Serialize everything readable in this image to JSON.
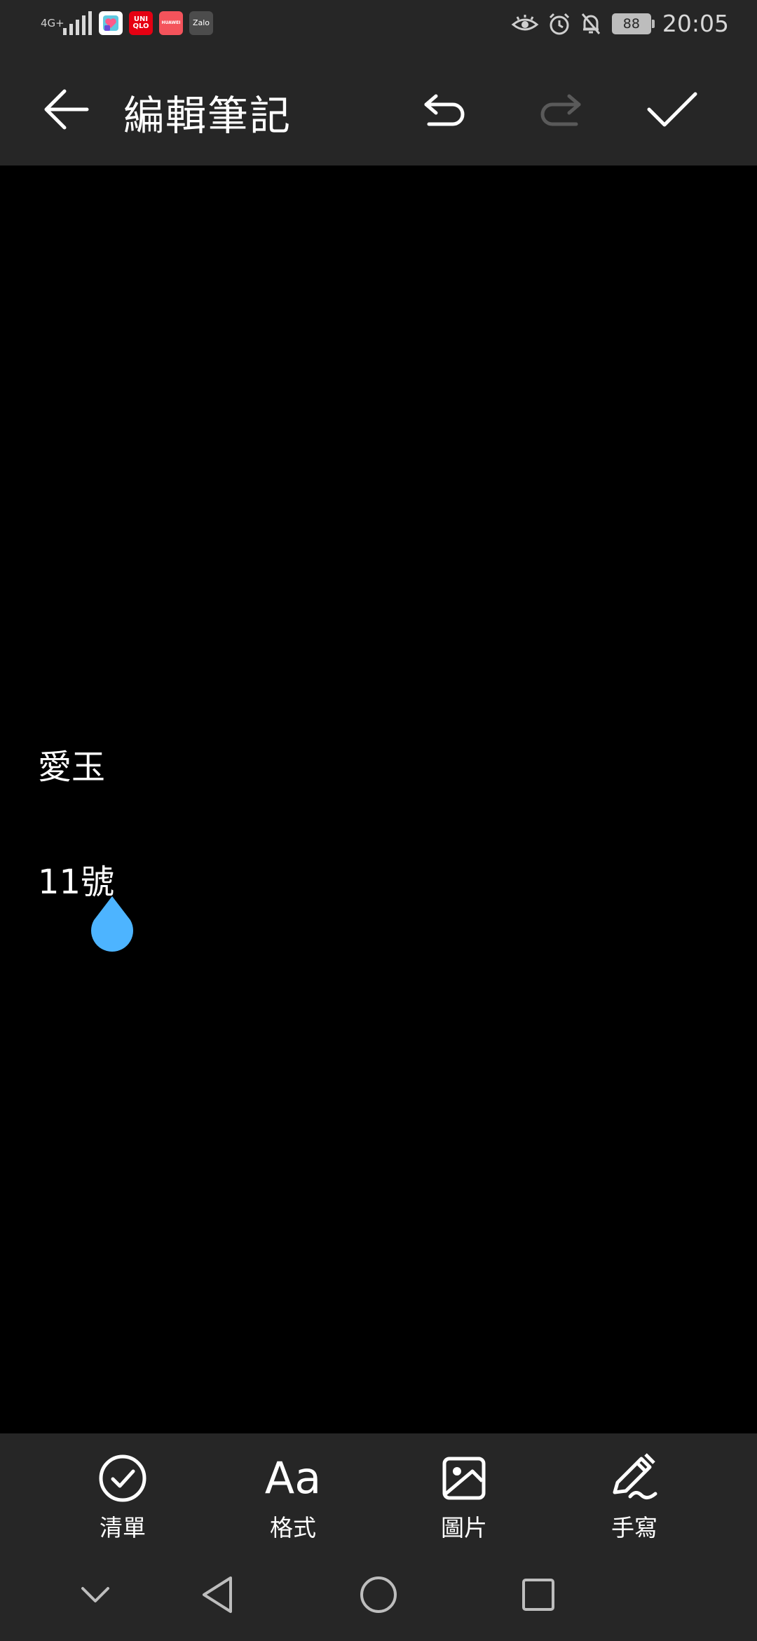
{
  "status_bar": {
    "network": "4G",
    "network_sub": "+",
    "notification_apps": [
      {
        "name": "health-app",
        "label": ""
      },
      {
        "name": "uniqlo-app",
        "label": "UNI QLO"
      },
      {
        "name": "huawei-app",
        "label": "HUAWEI"
      },
      {
        "name": "zalo-app",
        "label": "Zalo"
      }
    ],
    "battery": "88",
    "time": "20:05"
  },
  "app_bar": {
    "title": "編輯筆記"
  },
  "note": {
    "lines": [
      "愛玉",
      "11號"
    ]
  },
  "toolbar": {
    "items": [
      {
        "label": "清單"
      },
      {
        "label": "格式",
        "glyph": "Aa"
      },
      {
        "label": "圖片"
      },
      {
        "label": "手寫"
      }
    ]
  },
  "colors": {
    "bar_bg": "#262626",
    "content_bg": "#000000",
    "accent_handle": "#4db4ff",
    "icon_active": "#ffffff",
    "icon_disabled": "#5a5a5a"
  }
}
